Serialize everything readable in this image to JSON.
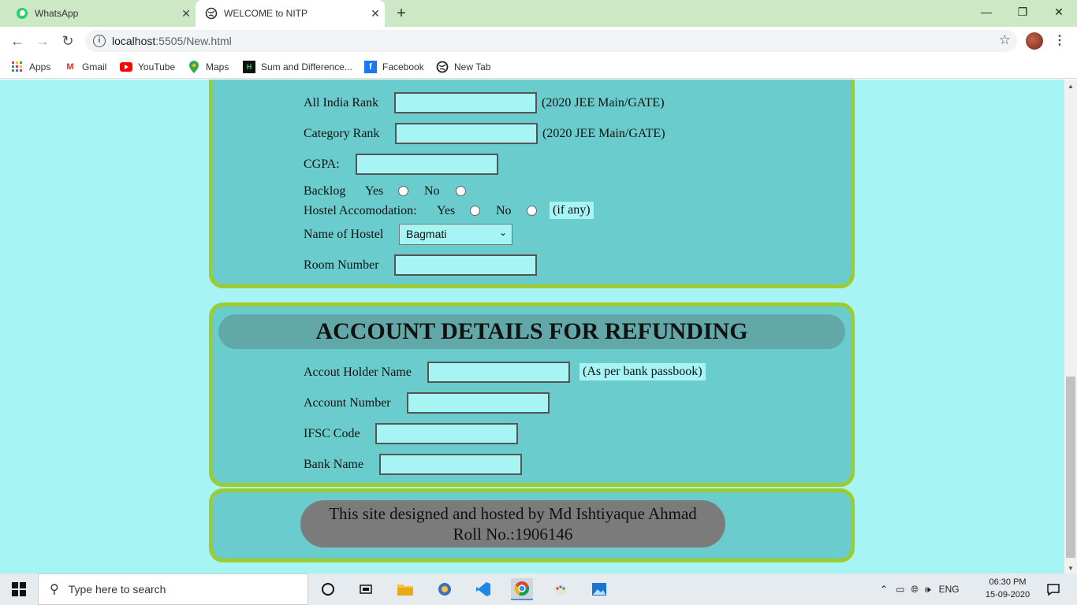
{
  "browser": {
    "tabs": [
      {
        "title": "WhatsApp",
        "active": false
      },
      {
        "title": "WELCOME to NITP",
        "active": true
      }
    ],
    "url_host": "localhost",
    "url_rest": ":5505/New.html",
    "bookmarks": [
      {
        "label": "Apps",
        "icon": "apps-grid-icon"
      },
      {
        "label": "Gmail",
        "icon": "gmail-icon"
      },
      {
        "label": "YouTube",
        "icon": "youtube-icon"
      },
      {
        "label": "Maps",
        "icon": "maps-icon"
      },
      {
        "label": "Sum and Difference...",
        "icon": "hackerrank-icon"
      },
      {
        "label": "Facebook",
        "icon": "facebook-icon"
      },
      {
        "label": "New Tab",
        "icon": "globe-icon"
      }
    ]
  },
  "admission": {
    "all_india_rank_label": "All India Rank",
    "all_india_rank_hint": "(2020 JEE Main/GATE)",
    "category_rank_label": "Category Rank",
    "category_rank_hint": "(2020 JEE Main/GATE)",
    "cgpa_label": "CGPA:",
    "backlog_label": "Backlog",
    "yes_label": "Yes",
    "no_label": "No",
    "hostel_label": "Hostel Accomodation:",
    "hostel_hint": "(if any)",
    "hostel_name_label": "Name of Hostel",
    "hostel_selected": "Bagmati",
    "room_label": "Room Number"
  },
  "account": {
    "heading": "ACCOUNT DETAILS FOR REFUNDING",
    "holder_label": "Accout Holder Name",
    "holder_hint": "(As per bank passbook)",
    "number_label": "Account Number",
    "ifsc_label": "IFSC Code",
    "bank_label": "Bank Name"
  },
  "footer": {
    "line1": "This site designed and hosted by Md Ishtiyaque Ahmad",
    "line2": "Roll No.:1906146"
  },
  "taskbar": {
    "search_placeholder": "Type here to search",
    "lang": "ENG",
    "time": "06:30 PM",
    "date": "15-09-2020"
  },
  "colors": {
    "page_bg": "#a6f4f3",
    "panel_bg": "#6acccc",
    "panel_border": "#9ccc2f",
    "heading_bg": "#62a8a8",
    "footer_pill": "#7b7b7b"
  }
}
